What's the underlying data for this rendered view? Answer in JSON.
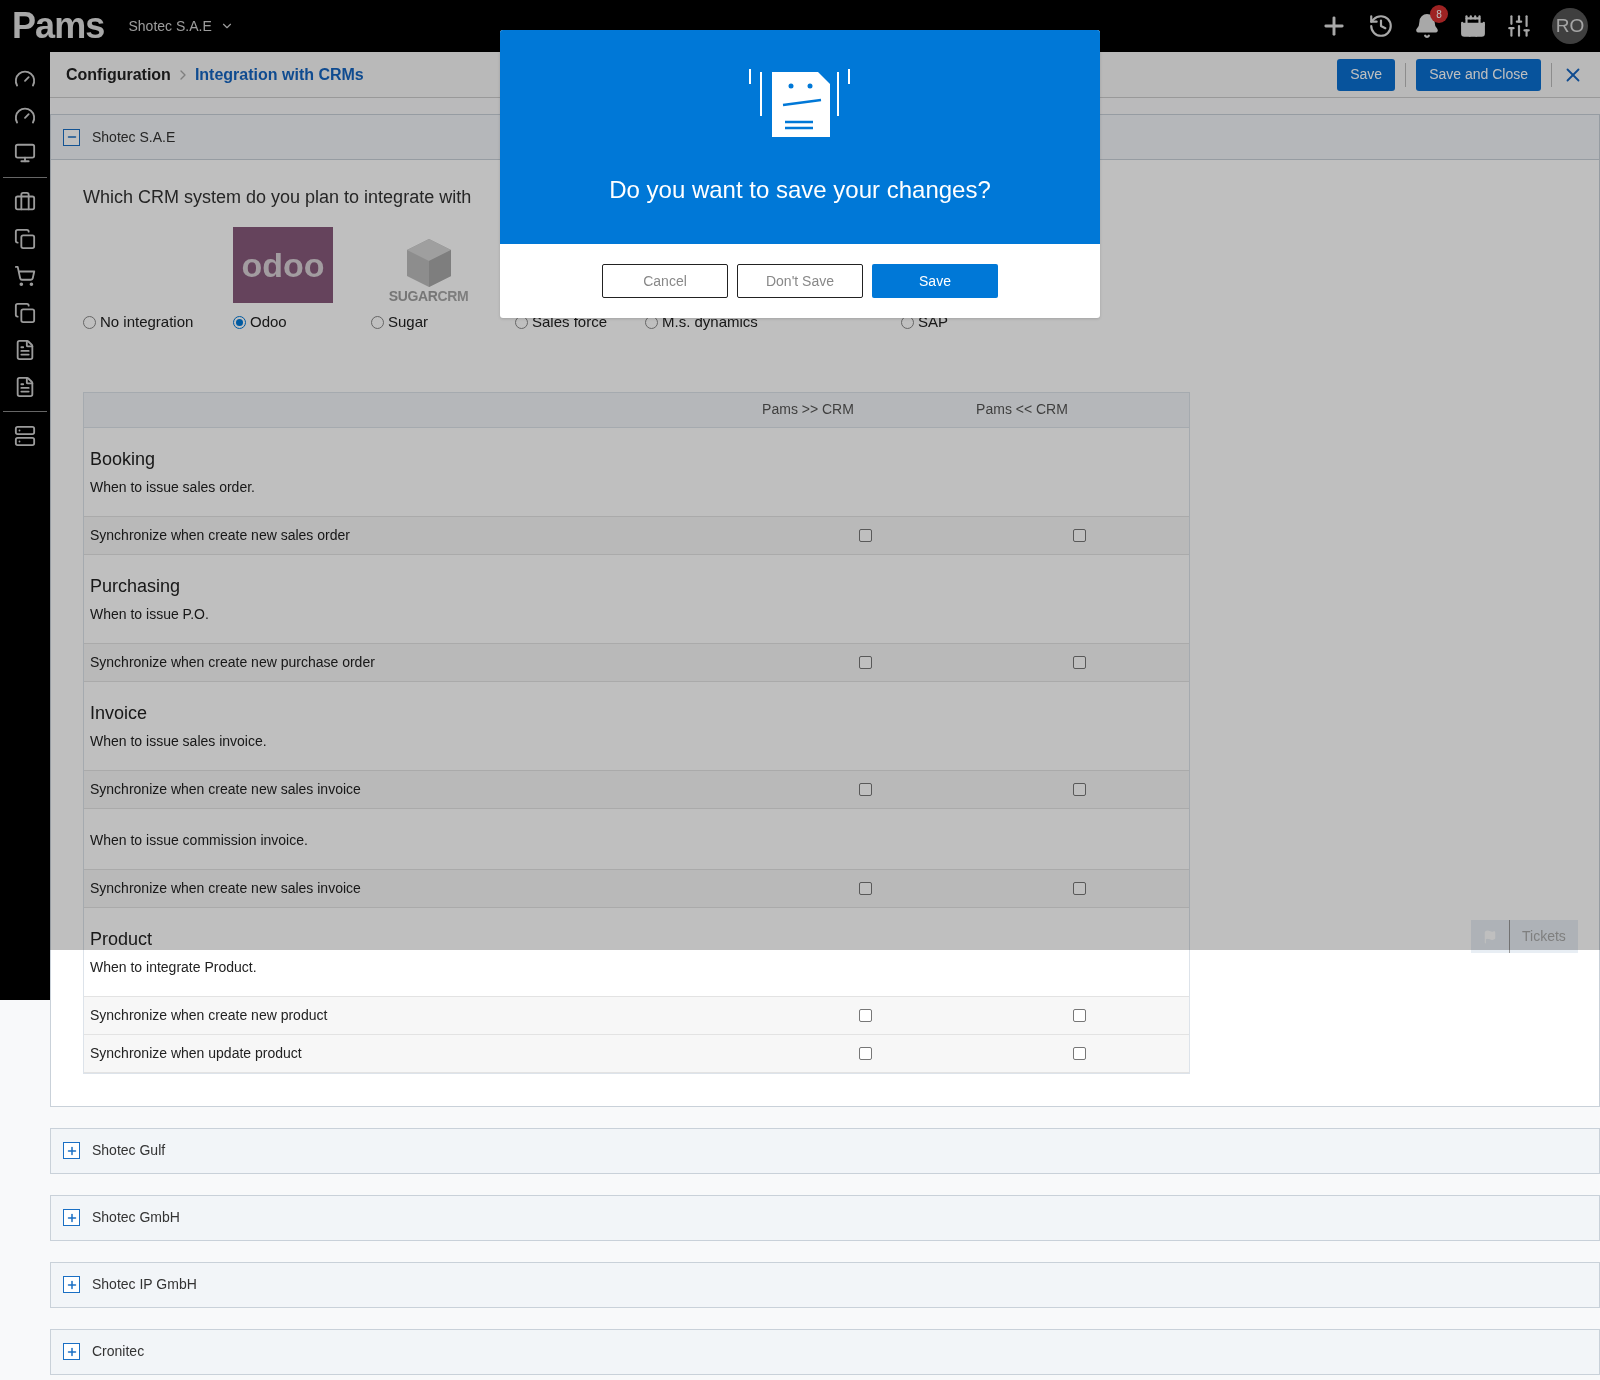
{
  "topbar": {
    "logo": "Pams",
    "company": "Shotec S.A.E",
    "notifications": "8",
    "avatar": "RO"
  },
  "sidebar": {
    "groups": [
      [
        {
          "kind": "gauge"
        },
        {
          "kind": "gauge"
        },
        {
          "kind": "monitor"
        }
      ],
      [
        {
          "kind": "briefcase"
        },
        {
          "kind": "squares"
        },
        {
          "kind": "cart"
        },
        {
          "kind": "squares"
        },
        {
          "kind": "invoice"
        },
        {
          "kind": "invoice"
        }
      ],
      [
        {
          "kind": "server"
        }
      ]
    ]
  },
  "header": {
    "breadcrumb": [
      "Configuration",
      "Integration with CRMs"
    ],
    "buttons": [
      "Save",
      "Save and Close"
    ]
  },
  "panels": [
    {
      "title": "Shotec S.A.E",
      "expanded": true
    },
    {
      "title": "Shotec Gulf",
      "expanded": false
    },
    {
      "title": "Shotec GmbH",
      "expanded": false
    },
    {
      "title": "Shotec IP GmbH",
      "expanded": false
    },
    {
      "title": "Cronitec",
      "expanded": false
    }
  ],
  "question": "Which CRM system do you plan to integrate with",
  "crm_options": [
    {
      "label": "No integration",
      "selected": false
    },
    {
      "label": "Odoo",
      "selected": true,
      "logo": {
        "kind": "odoo",
        "text": "odoo"
      }
    },
    {
      "label": "Sugar",
      "selected": false,
      "logo": {
        "kind": "sugar",
        "text": "SUGAR",
        "text2": "CRM"
      }
    },
    {
      "label": "Sales force",
      "selected": false
    },
    {
      "label": "M.s. dynamics",
      "selected": false
    },
    {
      "label": "SAP",
      "selected": false
    }
  ],
  "table": {
    "columns": [
      "Pams >> CRM",
      "Pams << CRM"
    ],
    "sections": [
      {
        "title": "Booking",
        "subtitle": "When to issue sales order.",
        "rows": [
          {
            "label": "Synchronize when create new sales order",
            "to_crm": false,
            "from_crm": false
          }
        ]
      },
      {
        "title": "Purchasing",
        "subtitle": "When to issue P.O.",
        "rows": [
          {
            "label": "Synchronize when create new purchase order",
            "to_crm": false,
            "from_crm": false
          }
        ]
      },
      {
        "title": "Invoice",
        "subtitle": "When to issue sales invoice.",
        "rows": [
          {
            "label": "Synchronize when create new sales invoice",
            "to_crm": false,
            "from_crm": false
          }
        ]
      },
      {
        "subtitle": "When to issue commission invoice.",
        "rows": [
          {
            "label": "Synchronize when create new sales invoice",
            "to_crm": false,
            "from_crm": false
          }
        ]
      },
      {
        "title": "Product",
        "subtitle": "When to integrate Product.",
        "rows": [
          {
            "label": "Synchronize when create new product",
            "to_crm": false,
            "from_crm": false
          },
          {
            "label": "Synchronize when update product",
            "to_crm": false,
            "from_crm": false
          }
        ]
      }
    ]
  },
  "tickets": "Tickets",
  "dialog": {
    "title": "Do you want to save your changes?",
    "buttons": [
      {
        "label": "Cancel",
        "kind": "outline"
      },
      {
        "label": "Don't Save",
        "kind": "outline"
      },
      {
        "label": "Save",
        "kind": "primary"
      }
    ]
  }
}
